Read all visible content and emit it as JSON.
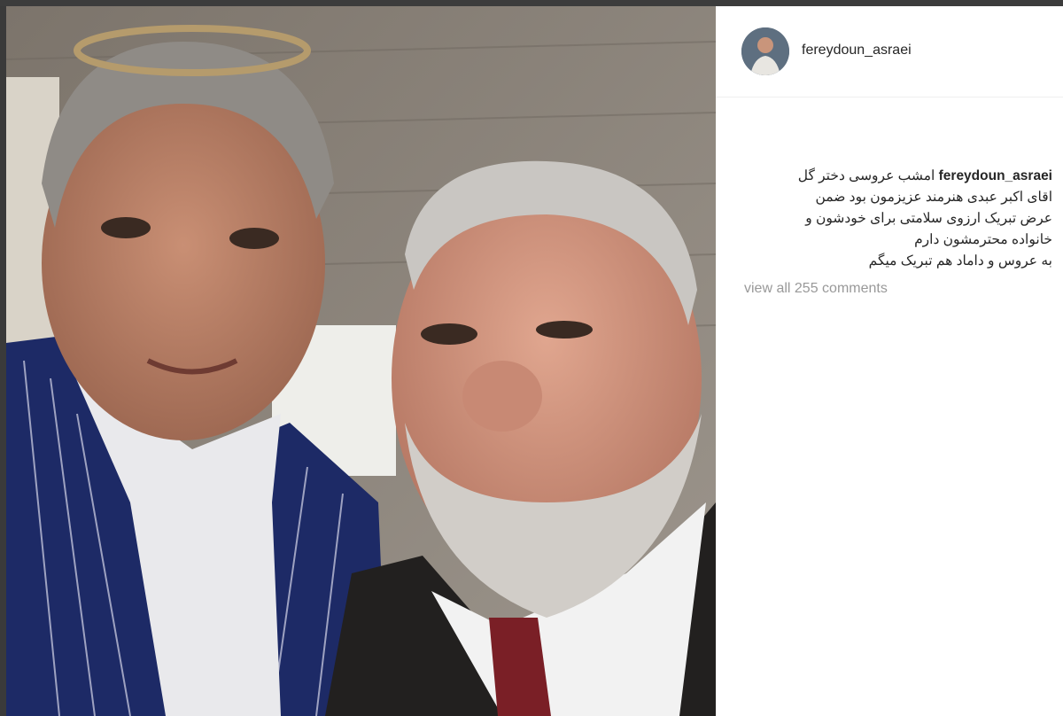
{
  "post": {
    "username": "fereydoun_asraei",
    "caption_author": "fereydoun_asraei",
    "caption_lines": [
      "امشب عروسی دختر گل",
      "اقای اکبر عبدی هنرمند عزیزمون بود ضمن",
      "عرض تبریک ارزوی سلامتی برای خودشون و",
      "خانواده محترمشون دارم",
      "به عروس و داماد هم تبریک میگم"
    ],
    "view_comments": "view all 255 comments"
  },
  "colors": {
    "panel_bg": "#ffffff",
    "text": "#262626",
    "muted": "#999999"
  },
  "icons": {
    "avatar": "profile-photo"
  }
}
